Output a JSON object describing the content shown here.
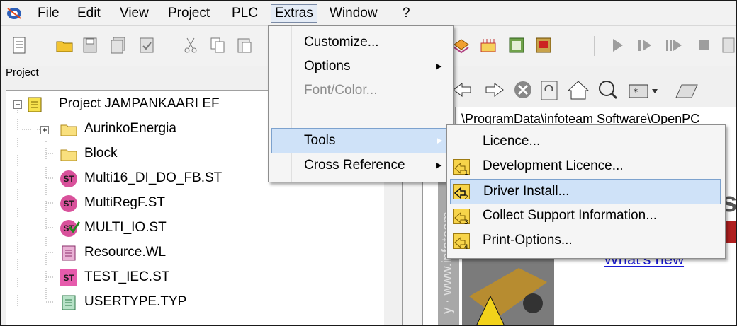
{
  "menubar": {
    "items": [
      "File",
      "Edit",
      "View",
      "Project",
      "PLC",
      "Extras",
      "Window",
      "?"
    ],
    "active": "Extras"
  },
  "project_panel": {
    "title": "Project",
    "tree": [
      {
        "label": "Project JAMPANKAARI EF",
        "icon": "project-icon",
        "expander": "minus"
      },
      {
        "label": "AurinkoEnergia",
        "icon": "folder-icon",
        "expander": "plus"
      },
      {
        "label": "Block",
        "icon": "folder-icon"
      },
      {
        "label": "Multi16_DI_DO_FB.ST",
        "icon": "st-file-icon",
        "badge": "ST"
      },
      {
        "label": "MultiRegF.ST",
        "icon": "st-file-icon",
        "badge": "ST"
      },
      {
        "label": "MULTI_IO.ST",
        "icon": "st-file-check-icon",
        "badge": "ST"
      },
      {
        "label": "Resource.WL",
        "icon": "resource-file-icon"
      },
      {
        "label": "TEST_IEC.ST",
        "icon": "st-file-icon",
        "badge": "ST"
      },
      {
        "label": "USERTYPE.TYP",
        "icon": "type-file-icon"
      }
    ]
  },
  "browser": {
    "address_text": "\\ProgramData\\infoteam Software\\OpenPC",
    "whats_new_link": "What's new",
    "side_text": "y · www.infoteam"
  },
  "extras_menu": {
    "items": [
      {
        "label": "Customize...",
        "has_submenu": false,
        "disabled": false
      },
      {
        "label": "Options",
        "has_submenu": true,
        "disabled": false
      },
      {
        "label": "Font/Color...",
        "has_submenu": false,
        "disabled": true
      },
      {
        "label": "Tools",
        "has_submenu": true,
        "disabled": false,
        "highlighted": true
      },
      {
        "label": "Cross Reference",
        "has_submenu": true,
        "disabled": false
      }
    ]
  },
  "tools_menu": {
    "items": [
      {
        "label": "Licence...",
        "icon": null
      },
      {
        "label": "Development Licence...",
        "icon": "tool-1-icon",
        "icon_text": "1"
      },
      {
        "label": "Driver Install...",
        "icon": "tool-2-icon",
        "icon_text": "2",
        "highlighted": true
      },
      {
        "label": "Collect Support Information...",
        "icon": "tool-3-icon",
        "icon_text": "3"
      },
      {
        "label": "Print-Options...",
        "icon": "tool-4-icon",
        "icon_text": "4"
      }
    ]
  },
  "colors": {
    "highlight": "#cfe2f8",
    "st_badge": "#d9519b",
    "link": "#1a1ad0"
  }
}
